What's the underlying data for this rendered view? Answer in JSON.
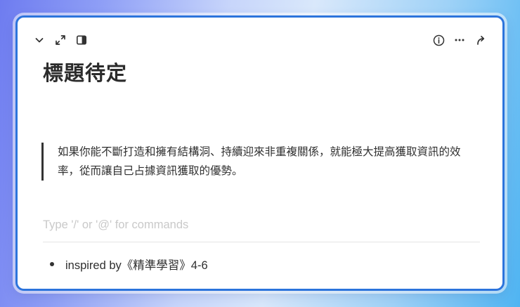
{
  "toolbar": {
    "left_icons": [
      "chevron-down-icon",
      "expand-icon",
      "sidebar-panel-icon"
    ],
    "right_icons": [
      "info-icon",
      "more-icon",
      "share-arrow-icon"
    ]
  },
  "page": {
    "title": "標題待定"
  },
  "quote": {
    "text": "如果你能不斷打造和擁有結構洞、持續迎來非重複關係，就能極大提高獲取資訊的效率，從而讓自己占據資訊獲取的優勢。"
  },
  "editor": {
    "placeholder": "Type '/' or '@' for commands",
    "value": ""
  },
  "list": {
    "items": [
      {
        "text": "inspired by《精準學習》4-6"
      }
    ]
  },
  "colors": {
    "accent_border": "#2c74dc",
    "text": "#2f2f2f",
    "placeholder": "#c9c9c9"
  }
}
